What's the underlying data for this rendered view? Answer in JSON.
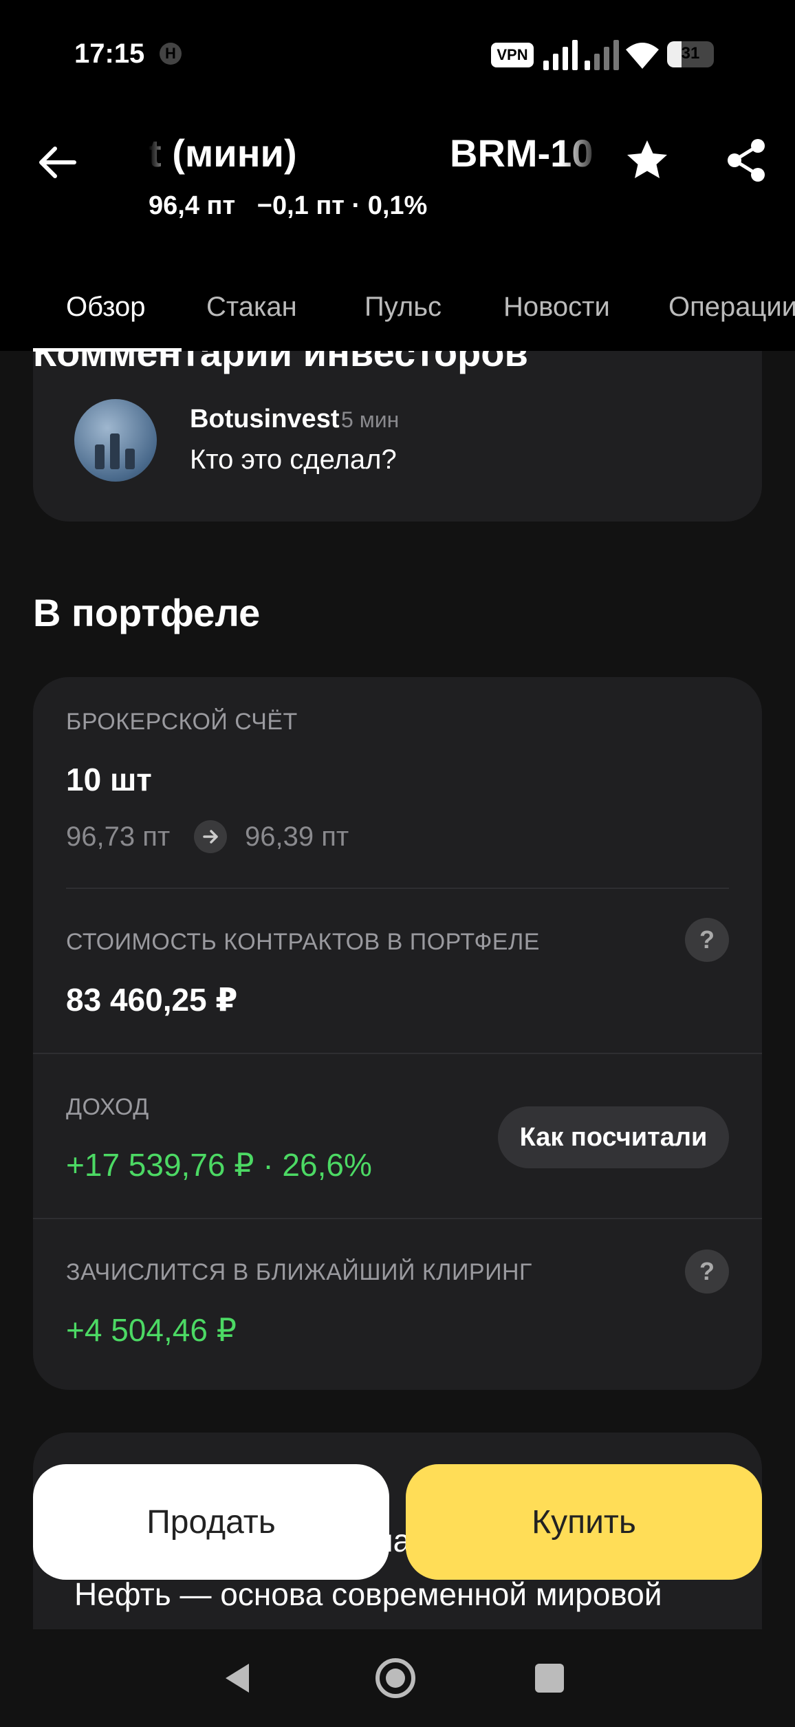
{
  "status_bar": {
    "time": "17:15",
    "network_icon": "h-icon",
    "vpn": "VPN",
    "battery": "31",
    "battery_level": 0.31
  },
  "header": {
    "title_part1": "t (мини)",
    "title_part2": "BRM-10",
    "price": "96,4 пт",
    "change": "−0,1 пт · 0,1%",
    "back_icon": "arrow-left-icon",
    "favorite_icon": "star-icon",
    "share_icon": "share-icon"
  },
  "tabs": [
    {
      "label": "Обзор",
      "active": true
    },
    {
      "label": "Стакан"
    },
    {
      "label": "Пульс"
    },
    {
      "label": "Новости"
    },
    {
      "label": "Операции"
    }
  ],
  "comments": {
    "title": "Комментарии инвесторов",
    "items": [
      {
        "author": "Botusinvest",
        "time": "5 мин",
        "text": "Кто это сделал?"
      }
    ]
  },
  "portfolio": {
    "title": "В портфеле",
    "account_label": "БРОКЕРСКОЙ СЧЁТ",
    "quantity": "10 шт",
    "avg_price": "96,73 пт",
    "current_price": "96,39 пт",
    "value_label": "СТОИМОСТЬ КОНТРАКТОВ В ПОРТФЕЛЕ",
    "value": "83 460,25 ₽",
    "income_label": "ДОХОД",
    "income": "+17 539,76 ₽ · 26,6%",
    "how_calc": "Как посчитали",
    "clearing_label": "ЗАЧИСЛИТСЯ В БЛИЖАЙШИЙ КЛИРИНГ",
    "clearing": "+4 504,46 ₽",
    "help_symbol": "?"
  },
  "about": {
    "partial_line": "мар",
    "text": "Нефть — основа современной мировой"
  },
  "actions": {
    "sell": "Продать",
    "buy": "Купить"
  },
  "colors": {
    "background": "#121212",
    "card": "#1f1f21",
    "positive": "#4cd964",
    "buy_button": "#ffdd57",
    "sell_button": "#ffffff"
  }
}
